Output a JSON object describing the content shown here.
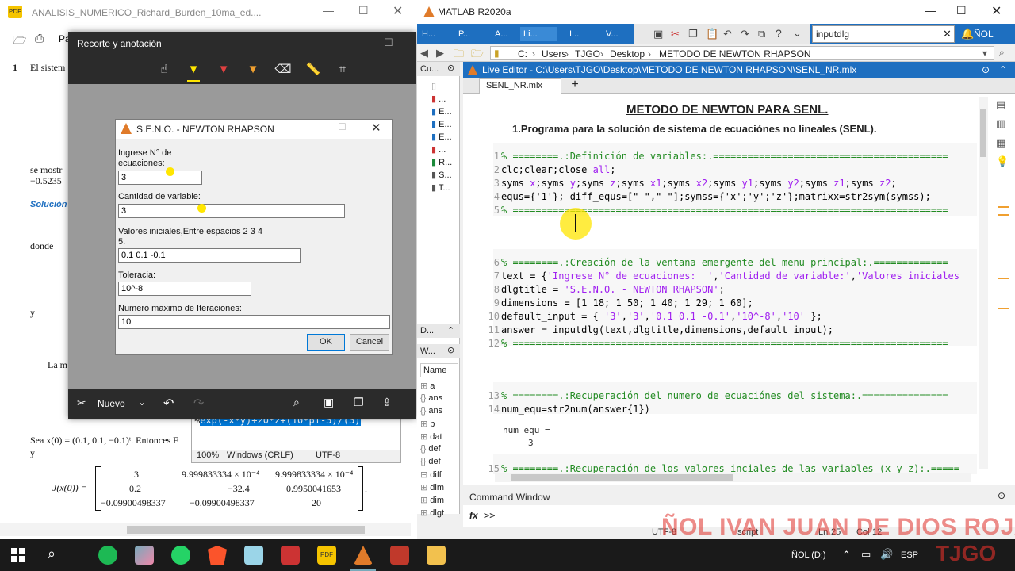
{
  "pdf": {
    "title": "ANALISIS_NUMERICO_Richard_Burden_10ma_ed....",
    "toolbar_partial": "Pa",
    "line_number": "1",
    "text_el_sistema": "El sistem",
    "text_se_mostro": "se mostr",
    "text_neg_value": "−0.5235",
    "text_solucion": "Solución",
    "text_donde": "donde",
    "text_y": "y",
    "text_la_m": "La m",
    "text_sea": "Sea x",
    "text_sea_rest": "(0) = (0.1, 0.1, −0.1)ᵗ. Entonces F",
    "text_y2": "y",
    "jacobian_label": "J(x",
    "jacobian_label_rest": "(0)) =",
    "matrix": [
      [
        "3",
        "9.999833334 × 10⁻⁴",
        "9.999833334 × 10⁻⁴"
      ],
      [
        "0.2",
        "−32.4",
        "0.9950041653"
      ],
      [
        "−0.09900498337",
        "−0.09900498337",
        "20"
      ]
    ],
    "matrix_dot": "."
  },
  "notepad": {
    "selected_line": "exp(-x*y)+20*z+(10*pi-3)/(3)",
    "prefix": "%",
    "zoom": "100%",
    "line_ending": "Windows (CRLF)",
    "encoding": "UTF-8"
  },
  "snip": {
    "title": "Recorte y anotación",
    "new_label": "Nuevo"
  },
  "dialog": {
    "title": "S.E.N.O. - NEWTON RHAPSON",
    "label1": "Ingrese N° de",
    "label1b": "ecuaciones:",
    "value1": "3",
    "label2": "Cantidad de variable:",
    "value2": "3",
    "label3": "Valores iniciales,Entre espacios 2 3 4",
    "label3b": "5.",
    "value3": "0.1 0.1 -0.1",
    "label4": "Toleracia:",
    "value4": "10^-8",
    "label5": "Numero maximo de Iteraciones:",
    "value5": "10",
    "ok": "OK",
    "cancel": "Cancel"
  },
  "matlab": {
    "title": "MATLAB R2020a",
    "tabs": [
      "H...",
      "P...",
      "A...",
      "Li...",
      "I...",
      "V..."
    ],
    "search_value": "inputdlg",
    "user_label": "ÑOL",
    "path": [
      "C:",
      "Users",
      "TJGO",
      "Desktop",
      "METODO DE NEWTON RHAPSON"
    ],
    "current_folder": "Cu...",
    "folder_items": [
      "...",
      "E...",
      "E...",
      "E...",
      "...",
      "R...",
      "S...",
      "T..."
    ],
    "details": "D...",
    "workspace": "W...",
    "ws_header": "Name",
    "ws_items": [
      "a",
      "ans",
      "ans",
      "b",
      "dat",
      "def",
      "def",
      "diff",
      "dim",
      "dim",
      "dlgt"
    ],
    "editor_title": "Live Editor - C:\\Users\\TJGO\\Desktop\\METODO DE NEWTON RHAPSON\\SENL_NR.mlx",
    "file_tab": "SENL_NR.mlx",
    "doc_title": "METODO DE NEWTON PARA SENL.",
    "doc_subtitle": "1.Programa para la solución de sistema de ecuaciónes no lineales (SENL).",
    "code": {
      "l1": "% ========.:Definición de variables:.=========================================",
      "l2a": "clc;clear;close ",
      "l2b": "all",
      "l2c": ";",
      "l3a": "syms ",
      "l3b": "x",
      "l3c": ";syms ",
      "l3d": "y",
      "l3e": ";syms ",
      "l3f": "z",
      "l3g": ";syms ",
      "l3h": "x1",
      "l3i": ";syms ",
      "l3j": "x2",
      "l3k": ";syms ",
      "l3l": "y1",
      "l3m": ";syms ",
      "l3n": "y2",
      "l3o": ";syms ",
      "l3p": "z1",
      "l3q": ";syms ",
      "l3r": "z2",
      "l3s": ";",
      "l4": "equs={'1'}; diff_equs=[\"-\",\"-\"];symss={'x';'y';'z'};matrixx=str2sym(symss);",
      "l5": "% ============================================================================",
      "l6": "% ========.:Creación de la ventana emergente del menu principal:.=============",
      "l7a": "text = {",
      "l7b": "'Ingrese N° de ecuaciones:  '",
      "l7c": ",",
      "l7d": "'Cantidad de variable:'",
      "l7e": ",",
      "l7f": "'Valores iniciales",
      "l8a": "dlgtitle = ",
      "l8b": "'S.E.N.O. - NEWTON RHAPSON'",
      "l8c": ";",
      "l9": "dimensions = [1 18; 1 50; 1 40; 1 29; 1 60];",
      "l10a": "default_input = { ",
      "l10b": "'3'",
      "l10c": ",",
      "l10d": "'3'",
      "l10e": ",",
      "l10f": "'0.1 0.1 -0.1'",
      "l10g": ",",
      "l10h": "'10^-8'",
      "l10i": ",",
      "l10j": "'10'",
      "l10k": " };",
      "l11": "answer = inputdlg(text,dlgtitle,dimensions,default_input);",
      "l12": "% ============================================================================",
      "l13": "% ========.:Recuperación del numero de ecuaciónes del sistema:.===============",
      "l14": "num_equ=str2num(answer{1})",
      "out1": "num_equ =",
      "out2": "3",
      "l15": "% ========.:Recuperación de los valores inciales de las variables (x-y-z):.====="
    },
    "line_numbers": [
      "1",
      "2",
      "3",
      "4",
      "5",
      "6",
      "7",
      "8",
      "9",
      "10",
      "11",
      "12",
      "13",
      "14",
      "15"
    ],
    "cmd_title": "Command Window",
    "cmd_prompt": ">>",
    "fx": "fx",
    "status_encoding": "UTF-8",
    "status_script": "script",
    "status_ln": "Ln",
    "status_ln_val": "25",
    "status_col": "Col",
    "status_col_val": "12"
  },
  "overlay": {
    "name": "ÑOL IVAN JUAN DE DIOS ROJAS",
    "tag": "TJGO"
  },
  "taskbar": {
    "lang": "ESP",
    "drive": "ÑOL (D:)"
  },
  "colors": {
    "matlab_blue": "#1e6fc0",
    "comment_green": "#228b22",
    "string_purple": "#a020f0",
    "highlight_yellow": "#ffe600",
    "overlay_red": "#e0302a"
  }
}
